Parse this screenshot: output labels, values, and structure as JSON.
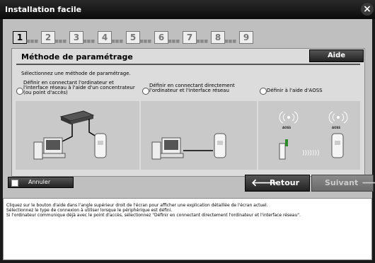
{
  "window": {
    "title": "Installation facile",
    "close_icon": "close-icon"
  },
  "steps": [
    "1",
    "2",
    "3",
    "4",
    "5",
    "6",
    "7",
    "8",
    "9"
  ],
  "active_step": 1,
  "panel": {
    "title": "Méthode de paramétrage",
    "help_label": "Aide",
    "instruction": "Sélectionnez une méthode de paramétrage.",
    "options": [
      {
        "lines": [
          "Définir en connectant l'ordinateur et",
          "l'interface réseau à l'aide d'un concentrateur",
          "(ou point d'accès)"
        ]
      },
      {
        "lines": [
          "Définir en connectant directement",
          "l'ordinateur et l'interface réseau"
        ]
      },
      {
        "lines": [
          "Définir à l'aide d'AOSS"
        ]
      }
    ],
    "aoss_label_left": "AOSS",
    "aoss_label_right": "AOSS"
  },
  "buttons": {
    "cancel": "Annuler",
    "back": "Retour",
    "next": "Suivant"
  },
  "help_text": [
    "Cliquez sur le bouton d'aide dans l'angle supérieur droit de l'écran pour afficher une explication détaillée de l'écran actuel.",
    "Sélectionnez le type de connexion à utiliser lorsque le périphérique est défini.",
    "Si l'ordinateur communique déjà avec le point d'accès, sélectionnez \"Définir en connectant directement l'ordinateur et l'interface réseau\"."
  ]
}
